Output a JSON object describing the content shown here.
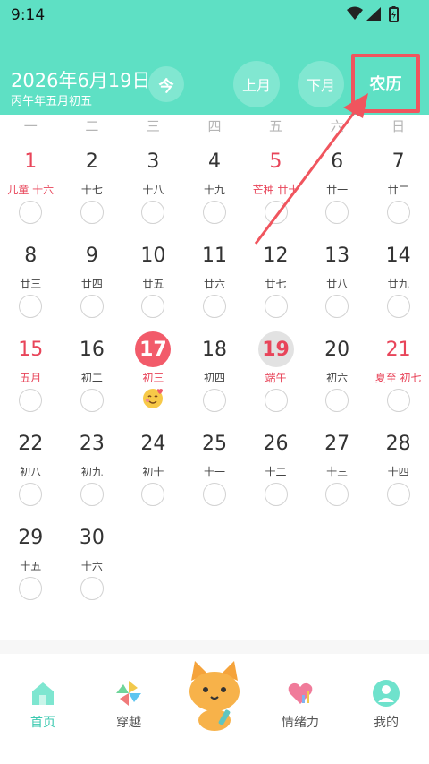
{
  "status_bar": {
    "time": "9:14"
  },
  "header": {
    "date": "2026年6月19日",
    "lunar_date": "丙午年五月初五",
    "today_label": "今",
    "prev_label": "上月",
    "next_label": "下月",
    "lunar_toggle_label": "农历"
  },
  "weekdays": [
    "一",
    "二",
    "三",
    "四",
    "五",
    "六",
    "日"
  ],
  "calendar": {
    "weeks": [
      [
        {
          "day": "1",
          "lunar": "儿童 十六",
          "red": true
        },
        {
          "day": "2",
          "lunar": "十七"
        },
        {
          "day": "3",
          "lunar": "十八"
        },
        {
          "day": "4",
          "lunar": "十九"
        },
        {
          "day": "5",
          "lunar": "芒种 廿十",
          "red": true
        },
        {
          "day": "6",
          "lunar": "廿一"
        },
        {
          "day": "7",
          "lunar": "廿二"
        }
      ],
      [
        {
          "day": "8",
          "lunar": "廿三"
        },
        {
          "day": "9",
          "lunar": "廿四"
        },
        {
          "day": "10",
          "lunar": "廿五"
        },
        {
          "day": "11",
          "lunar": "廿六"
        },
        {
          "day": "12",
          "lunar": "廿七"
        },
        {
          "day": "13",
          "lunar": "廿八"
        },
        {
          "day": "14",
          "lunar": "廿九"
        }
      ],
      [
        {
          "day": "15",
          "lunar": "五月",
          "red": true
        },
        {
          "day": "16",
          "lunar": "初二"
        },
        {
          "day": "17",
          "lunar": "初三",
          "today": true,
          "mood": "smiling-face-hearts"
        },
        {
          "day": "18",
          "lunar": "初四"
        },
        {
          "day": "19",
          "lunar": "端午",
          "selected": true
        },
        {
          "day": "20",
          "lunar": "初六"
        },
        {
          "day": "21",
          "lunar": "夏至 初七",
          "red": true
        }
      ],
      [
        {
          "day": "22",
          "lunar": "初八"
        },
        {
          "day": "23",
          "lunar": "初九"
        },
        {
          "day": "24",
          "lunar": "初十"
        },
        {
          "day": "25",
          "lunar": "十一"
        },
        {
          "day": "26",
          "lunar": "十二"
        },
        {
          "day": "27",
          "lunar": "十三"
        },
        {
          "day": "28",
          "lunar": "十四"
        }
      ],
      [
        {
          "day": "29",
          "lunar": "十五"
        },
        {
          "day": "30",
          "lunar": "十六"
        }
      ]
    ]
  },
  "bottom_nav": {
    "items": [
      {
        "label": "首页",
        "icon": "home-icon",
        "active": true
      },
      {
        "label": "穿越",
        "icon": "pinwheel-icon"
      },
      {
        "label": "",
        "icon": "cat-mascot-icon"
      },
      {
        "label": "情绪力",
        "icon": "heart-chart-icon"
      },
      {
        "label": "我的",
        "icon": "profile-icon"
      }
    ]
  },
  "colors": {
    "header_bg": "#5ee0c4",
    "accent_red": "#e8455a",
    "highlight_box": "#f0555e",
    "nav_active": "#3cc9b0"
  }
}
